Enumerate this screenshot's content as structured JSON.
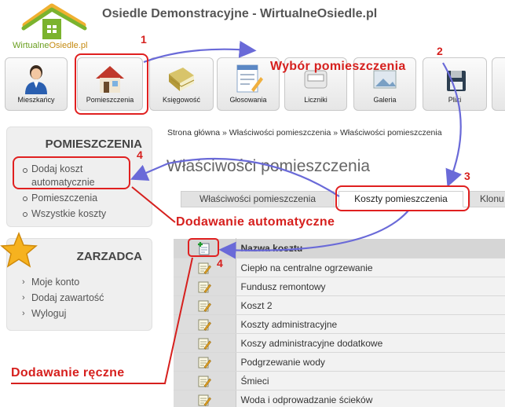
{
  "header": {
    "logo_text_part1": "Wirtualne",
    "logo_text_part2": "Osiedle.pl",
    "site_title": "Osiedle Demonstracyjne - WirtualneOsiedle.pl"
  },
  "nav": [
    {
      "label": "Mieszkańcy",
      "icon": "person-icon"
    },
    {
      "label": "Pomieszczenia",
      "icon": "house-icon"
    },
    {
      "label": "Księgowość",
      "icon": "ledger-books-icon"
    },
    {
      "label": "Głosowania",
      "icon": "ballot-icon"
    },
    {
      "label": "Liczniki",
      "icon": "meter-icon"
    },
    {
      "label": "Galeria",
      "icon": "gallery-icon"
    },
    {
      "label": "Pliki",
      "icon": "files-icon"
    }
  ],
  "sidebar": {
    "rooms_box": {
      "title": "POMIESZCZENIA",
      "items": [
        "Dodaj koszt automatycznie",
        "Pomieszczenia",
        "Wszystkie koszty"
      ]
    },
    "admin_box": {
      "title": "ZARZADCA",
      "items": [
        "Moje konto",
        "Dodaj zawartość",
        "Wyloguj"
      ]
    }
  },
  "breadcrumb": "Strona główna » Właściwości pomieszczenia » Właściwości pomieszczenia",
  "page_title": "Właściwości pomieszczenia",
  "tabs": [
    "Właściwości pomieszczenia",
    "Koszty pomieszczenia",
    "Klonu"
  ],
  "table": {
    "header": "Nazwa kosztu",
    "rows": [
      "Ciepło na centralne ogrzewanie",
      "Fundusz remontowy",
      "Koszt 2",
      "Koszty administracyjne",
      "Koszy administracyjne dodatkowe",
      "Podgrzewanie wody",
      "Śmieci",
      "Woda i odprowadzanie ścieków"
    ]
  },
  "annotations": {
    "num1": "1",
    "num2": "2",
    "num3": "3",
    "num4_side": "4",
    "num4_table": "4",
    "room_choice": "Wybór pomieszczenia",
    "auto_add": "Dodawanie automatyczne",
    "manual_add": "Dodawanie ręczne"
  },
  "colors": {
    "annotation_red": "#d6201e",
    "annotation_arrow_blue": "#6a6ad8",
    "logo_green": "#6a9e1f"
  }
}
